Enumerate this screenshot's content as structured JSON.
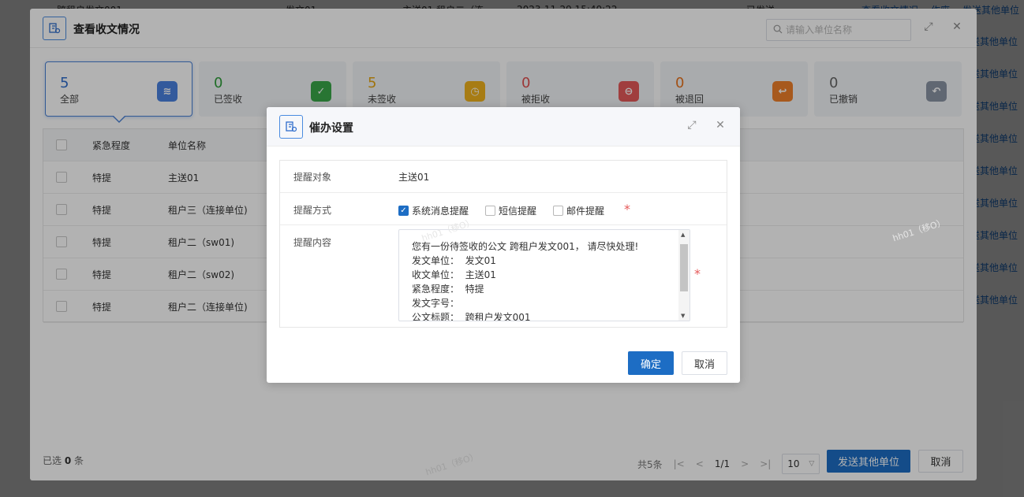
{
  "background": {
    "top_row": {
      "cells": [
        "跨租户发文001",
        "发文01",
        "主送01,租户二（连",
        "2023-11-29 15:40:22",
        "已发送"
      ],
      "links": [
        "查看收文情况",
        "作废",
        "发送其他单位"
      ]
    },
    "side_link": "发送其他单位"
  },
  "outer_dialog": {
    "title": "查看收文情况",
    "search_placeholder": "请输入单位名称",
    "stats": [
      {
        "count": "5",
        "label": "全部",
        "color": "#2f6dcc",
        "icon": "layers-icon",
        "icon_bg": "#4a82e0"
      },
      {
        "count": "0",
        "label": "已签收",
        "color": "#2e9e3a",
        "icon": "check-icon",
        "icon_bg": "#3aa84a"
      },
      {
        "count": "5",
        "label": "未签收",
        "color": "#e6a514",
        "icon": "clock-icon",
        "icon_bg": "#f0b21e"
      },
      {
        "count": "0",
        "label": "被拒收",
        "color": "#e05050",
        "icon": "minus-circle-icon",
        "icon_bg": "#e55a5a"
      },
      {
        "count": "0",
        "label": "被退回",
        "color": "#e8731e",
        "icon": "return-icon",
        "icon_bg": "#f0802a"
      },
      {
        "count": "0",
        "label": "已撤销",
        "color": "#666666",
        "icon": "undo-icon",
        "icon_bg": "#8a94a4"
      }
    ],
    "table": {
      "headers": [
        "紧急程度",
        "单位名称"
      ],
      "rows": [
        {
          "urgency": "特提",
          "name": "主送01"
        },
        {
          "urgency": "特提",
          "name": "租户三（连接单位)"
        },
        {
          "urgency": "特提",
          "name": "租户二（sw01)"
        },
        {
          "urgency": "特提",
          "name": "租户二（sw02)"
        },
        {
          "urgency": "特提",
          "name": "租户二（连接单位)"
        }
      ]
    },
    "footer": {
      "selected_prefix": "已选",
      "selected_count": "0",
      "selected_suffix": "条",
      "total": "共5条",
      "page": "1/1",
      "page_size": "10",
      "send_button": "发送其他单位",
      "cancel_button": "取消"
    }
  },
  "inner_dialog": {
    "title": "催办设置",
    "target_label": "提醒对象",
    "target_value": "主送01",
    "method_label": "提醒方式",
    "methods": [
      {
        "label": "系统消息提醒",
        "checked": true
      },
      {
        "label": "短信提醒",
        "checked": false
      },
      {
        "label": "邮件提醒",
        "checked": false
      }
    ],
    "content_label": "提醒内容",
    "content_text": "您有一份待签收的公文 跨租户发文001， 请尽快处理!\n发文单位：  发文01\n收文单位：  主送01\n紧急程度：  特提\n发文字号：\n公文标题：  跨租户发文001",
    "required_mark": "*",
    "confirm_button": "确定",
    "cancel_button": "取消"
  },
  "watermark": "hh01（移O）"
}
